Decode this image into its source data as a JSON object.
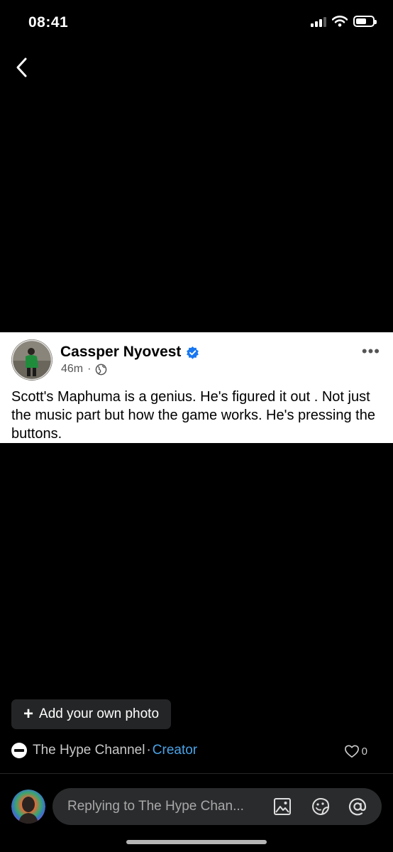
{
  "status_bar": {
    "time": "08:41",
    "signal_bars_active": 3,
    "signal_bars_total": 4,
    "battery_level": 0.55
  },
  "post": {
    "author": "Cassper Nyovest",
    "verified": true,
    "time_ago": "46m",
    "meta_separator": "·",
    "audience_icon": "globe-icon",
    "more_label": "•••",
    "text": "Scott's Maphuma is a genius. He's figured it out . Not just the music part but how the game works. He's pressing the buttons."
  },
  "add_photo": {
    "plus": "+",
    "label": "Add your own photo"
  },
  "page": {
    "name": "The Hype Channel",
    "separator": "·",
    "role": "Creator",
    "like_count": "0"
  },
  "composer": {
    "placeholder": "Replying to The Hype Chan...",
    "icons": [
      "image-icon",
      "sticker-icon",
      "mention-icon"
    ]
  },
  "colors": {
    "background": "#000000",
    "card": "#ffffff",
    "creator_link": "#4aa3e8",
    "verified_badge": "#1877f2",
    "input_bg": "#2a2b2d"
  }
}
